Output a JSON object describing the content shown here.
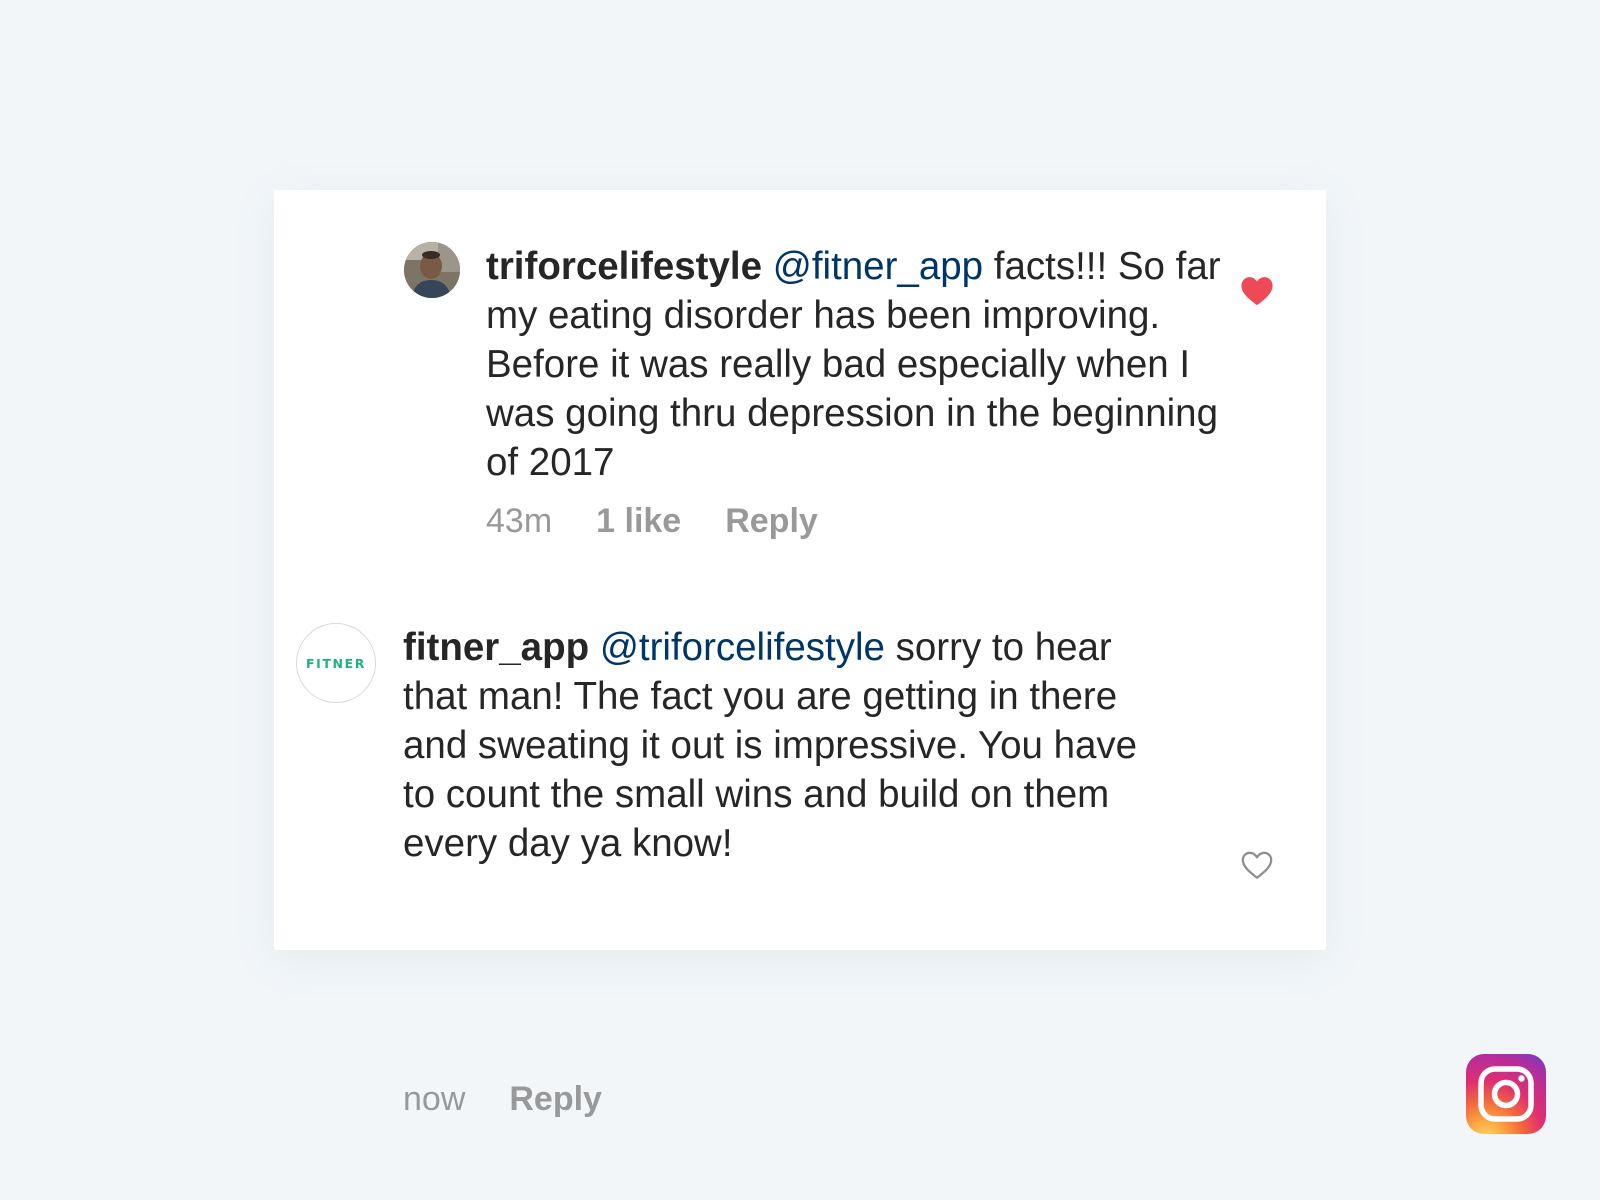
{
  "comments": [
    {
      "username": "triforcelifestyle",
      "mention": "@fitner_app",
      "text": "facts!!! So far my eating disorder has been improving. Before it was really bad especially when I was going thru depression in the beginning of 2017",
      "time": "43m",
      "likes": "1 like",
      "reply": "Reply",
      "liked": true,
      "avatar_icon": "user-photo"
    },
    {
      "username": "fitner_app",
      "mention": "@triforcelifestyle",
      "text": "sorry to hear that man! The fact you are getting in there and sweating it out is impressive. You have to count the small wins and build on them every day ya know!",
      "time": "now",
      "reply": "Reply",
      "liked": false,
      "avatar_logo_text": "FITNER"
    }
  ],
  "colors": {
    "background": "#f2f6f9",
    "card": "#ffffff",
    "text": "#262626",
    "mention": "#003569",
    "meta": "#999999",
    "liked_heart": "#ed4956",
    "fitner_green": "#20b27c"
  },
  "brand_icon": "instagram-logo-icon"
}
